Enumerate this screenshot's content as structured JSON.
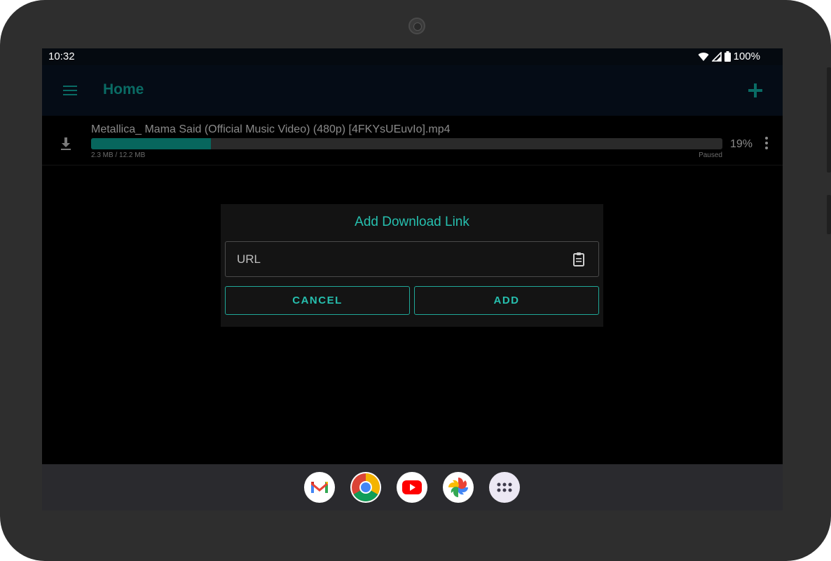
{
  "status_bar": {
    "time": "10:32",
    "battery": "100%"
  },
  "app_bar": {
    "title": "Home",
    "menu_icon": "hamburger-menu-icon",
    "add_icon": "plus-icon",
    "accent_color": "#0a6b64"
  },
  "downloads": [
    {
      "file_name": "Metallica_ Mama Said (Official Music Video) (480p) [4FKYsUEuvIo].mp4",
      "progress_percent": 19,
      "progress_text": "19%",
      "size_text": "2.3 MB / 12.2 MB",
      "state": "Paused",
      "icon": "download-icon"
    }
  ],
  "dialog": {
    "title": "Add Download Link",
    "url_placeholder": "URL",
    "url_value": "",
    "clipboard_icon": "clipboard-icon",
    "cancel_label": "CANCEL",
    "add_label": "ADD",
    "accent_color": "#26bfae"
  },
  "taskbar": {
    "apps": [
      "Gmail",
      "Chrome",
      "YouTube",
      "Photos",
      "App drawer"
    ]
  }
}
